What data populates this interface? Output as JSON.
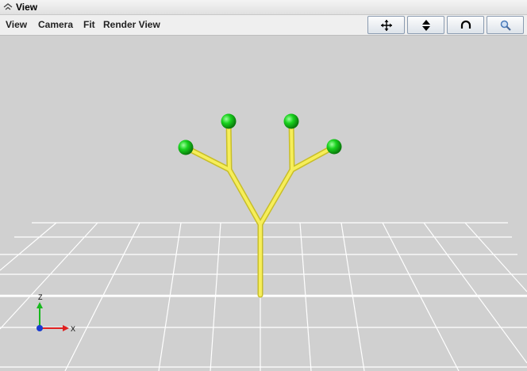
{
  "window": {
    "title": "View"
  },
  "menu": [
    {
      "label": "View"
    },
    {
      "label": "Camera"
    },
    {
      "label": "Fit"
    },
    {
      "label": "Render View"
    }
  ],
  "toolbar": {
    "icons": [
      "pan-icon",
      "move-down-icon",
      "orbit-icon",
      "zoom-icon"
    ]
  },
  "axes": {
    "z_label": "Z",
    "x_label": "X"
  },
  "colors": {
    "background": "#d0d0d0",
    "grid": "#ffffff",
    "branch": "#f0e64b",
    "tip": "#19d21e",
    "axis_x": "#e02020",
    "axis_z": "#18b81e",
    "axis_y": "#1a3cd0"
  }
}
